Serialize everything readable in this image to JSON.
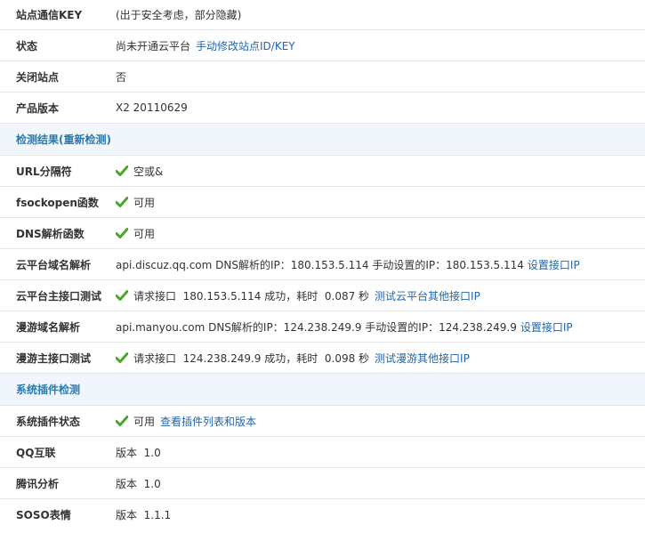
{
  "rows_top": [
    {
      "label": "站点通信KEY",
      "value": "(出于安全考虑，部分隐藏)"
    },
    {
      "label": "状态",
      "value": "尚未开通云平台",
      "link": "手动修改站点ID/KEY"
    },
    {
      "label": "关闭站点",
      "value": "否"
    },
    {
      "label": "产品版本",
      "value": "X2 20110629"
    }
  ],
  "section_check": {
    "title": "检测结果",
    "recheck": "(重新检测)"
  },
  "rows_check": [
    {
      "label": "URL分隔符",
      "value": "空或&"
    },
    {
      "label": "fsockopen函数",
      "value": "可用"
    },
    {
      "label": "DNS解析函数",
      "value": "可用"
    },
    {
      "label": "云平台域名解析",
      "value": "api.discuz.qq.com DNS解析的IP：180.153.5.114 手动设置的IP：180.153.5.114",
      "link": "设置接口IP"
    },
    {
      "label": "云平台主接口测试",
      "value": "请求接口  180.153.5.114 成功，耗时  0.087 秒",
      "link": "测试云平台其他接口IP"
    },
    {
      "label": "漫游域名解析",
      "value": "api.manyou.com DNS解析的IP：124.238.249.9 手动设置的IP：124.238.249.9",
      "link": "设置接口IP"
    },
    {
      "label": "漫游主接口测试",
      "value": "请求接口  124.238.249.9 成功，耗时  0.098 秒",
      "link": "测试漫游其他接口IP"
    }
  ],
  "section_plugins": {
    "title": "系统插件检测"
  },
  "rows_plugins": [
    {
      "label": "系统插件状态",
      "value": "可用",
      "link": "查看插件列表和版本"
    },
    {
      "label": "QQ互联",
      "value": "版本  1.0"
    },
    {
      "label": "腾讯分析",
      "value": "版本  1.0"
    },
    {
      "label": "SOSO表情",
      "value": "版本  1.1.1"
    }
  ],
  "colors": {
    "check": "#4ca52f",
    "link": "#2366a8",
    "section_bg": "#f0f6fb",
    "section_text": "#2a7ab0"
  }
}
